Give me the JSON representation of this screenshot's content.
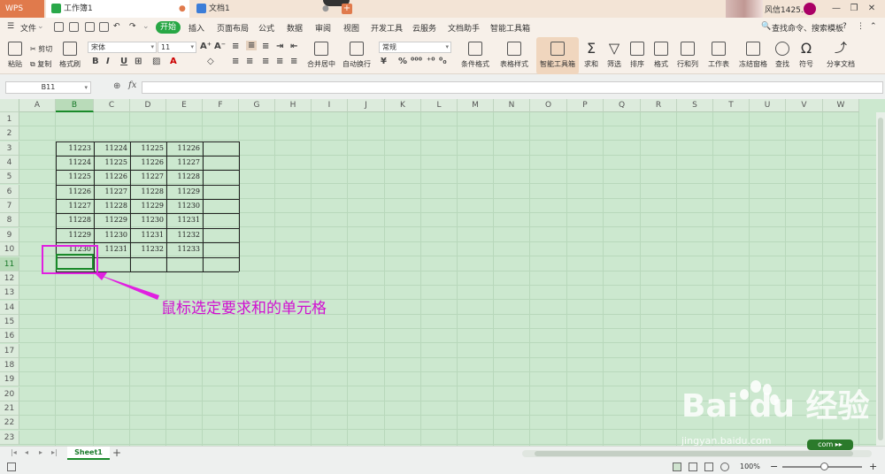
{
  "titlebar": {
    "app_name": "WPS",
    "tabs": [
      {
        "label": "工作簿1"
      },
      {
        "label": "文档1"
      }
    ],
    "user_name": "风信1425..."
  },
  "menubar": {
    "file_label": "文件",
    "start_label": "开始",
    "items": [
      "插入",
      "页面布局",
      "公式",
      "数据",
      "审阅",
      "视图",
      "开发工具",
      "云服务",
      "文档助手",
      "智能工具箱"
    ],
    "search_label": "查找命令、搜索模板"
  },
  "ribbon": {
    "paste": "粘贴",
    "cut": "剪切",
    "copy": "复制",
    "format_painter": "格式刷",
    "font_name": "宋体",
    "font_size": "11",
    "bold": "B",
    "italic": "I",
    "underline": "U",
    "merge_center": "合并居中",
    "auto_wrap": "自动换行",
    "number_format": "常规",
    "conditional_format": "条件格式",
    "table_style": "表格样式",
    "smart_toolbox": "智能工具箱",
    "sum": "求和",
    "filter": "筛选",
    "sort": "排序",
    "format": "格式",
    "rows_cols": "行和列",
    "worksheet": "工作表",
    "freeze": "冻结窗格",
    "find": "查找",
    "symbol": "符号",
    "share": "分享文档"
  },
  "formulabar": {
    "cell_ref": "B11",
    "fx": "fx",
    "formula": ""
  },
  "grid": {
    "columns": [
      "A",
      "B",
      "C",
      "D",
      "E",
      "F",
      "G",
      "H",
      "I",
      "J",
      "K",
      "L",
      "M",
      "N",
      "O",
      "P",
      "Q",
      "R",
      "S",
      "T",
      "U",
      "V",
      "W"
    ],
    "rows": [
      "1",
      "2",
      "3",
      "4",
      "5",
      "6",
      "7",
      "8",
      "9",
      "10",
      "11",
      "12",
      "13",
      "14",
      "15",
      "16",
      "17",
      "18",
      "19",
      "20",
      "21",
      "22",
      "23"
    ],
    "selected_col": "B",
    "selected_row": "11",
    "data": [
      [
        "11223",
        "11224",
        "11225",
        "11226"
      ],
      [
        "11224",
        "11225",
        "11226",
        "11227"
      ],
      [
        "11225",
        "11226",
        "11227",
        "11228"
      ],
      [
        "11226",
        "11227",
        "11228",
        "11229"
      ],
      [
        "11227",
        "11228",
        "11229",
        "11230"
      ],
      [
        "11228",
        "11229",
        "11230",
        "11231"
      ],
      [
        "11229",
        "11230",
        "11231",
        "11232"
      ],
      [
        "11230",
        "11231",
        "11232",
        "11233"
      ]
    ]
  },
  "annotation": {
    "text": "鼠标选定要求和的单元格",
    "color": "#d010d0"
  },
  "watermark": {
    "brand": "Bai du 经验",
    "url": "jingyan.baidu.com"
  },
  "sheetbar": {
    "sheet_name": "Sheet1",
    "add": "+"
  },
  "statusbar": {
    "zoom": "100%",
    "zoom_out": "−",
    "zoom_in": "+"
  }
}
